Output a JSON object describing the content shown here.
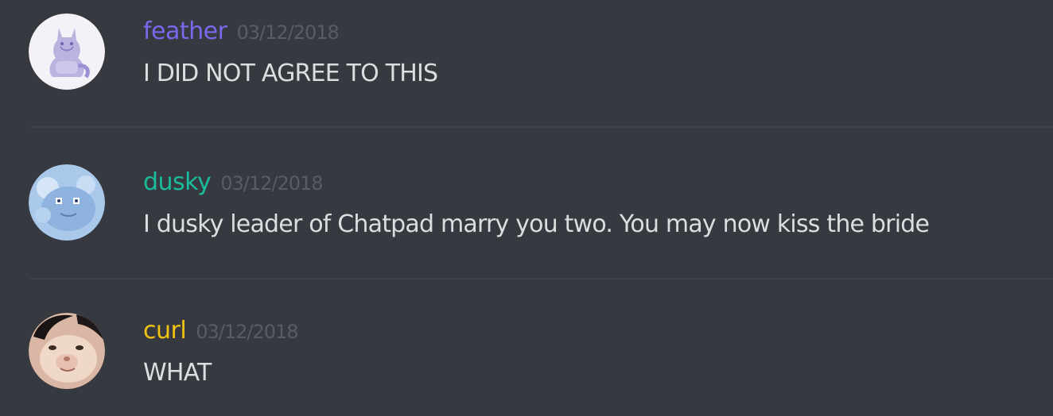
{
  "messages": [
    {
      "username": "feather",
      "username_color": "#7b68ee",
      "timestamp": "03/12/2018",
      "content": "I DID NOT AGREE TO THIS",
      "avatar": "cat-drawing-avatar"
    },
    {
      "username": "dusky",
      "username_color": "#1abc9c",
      "timestamp": "03/12/2018",
      "content": "I dusky leader of Chatpad marry you two. You may now kiss the bride",
      "avatar": "blue-creature-avatar"
    },
    {
      "username": "curl",
      "username_color": "#f1c40f",
      "timestamp": "03/12/2018",
      "content": "WHAT",
      "avatar": "cat-photo-avatar"
    }
  ],
  "colors": {
    "background": "#36393f",
    "divider": "#3f4248",
    "text": "#dcddde",
    "timestamp": "#585c63"
  }
}
